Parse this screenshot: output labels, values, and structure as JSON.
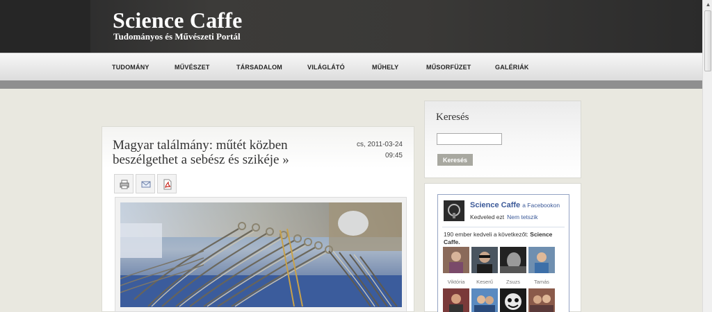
{
  "header": {
    "title": "Science Caffe",
    "subtitle": "Tudományos és Művészeti Portál"
  },
  "nav": {
    "items": [
      "TUDOMÁNY",
      "MŰVÉSZET",
      "TÁRSADALOM",
      "VILÁGLÁTÓ",
      "MŰHELY",
      "MŰSORFÜZET",
      "GALÉRIÁK"
    ]
  },
  "article": {
    "title": "Magyar találmány: műtét közben beszélgethet a sebész és szikéje »",
    "date": "cs, 2011-03-24",
    "time": "09:45",
    "tools": [
      "print-icon",
      "email-icon",
      "pdf-icon"
    ]
  },
  "search": {
    "heading": "Keresés",
    "button_label": "Keresés",
    "input_value": ""
  },
  "facebook": {
    "page_name": "Science Caffe",
    "page_suffix": "a Facebookon",
    "like_text": "Kedveled ezt",
    "unlike_text": "Nem tetszik",
    "count_text": "190 ember kedveli a következőt:",
    "count_target": "Science Caffe.",
    "faces": [
      "Viktória",
      "Keserű",
      "Zsuzs",
      "Tamás",
      "",
      "",
      "",
      ""
    ]
  },
  "colors": {
    "header_bg": "#2e2e2e",
    "fb_blue": "#3b5998",
    "page_bg": "#e9e8e0"
  }
}
